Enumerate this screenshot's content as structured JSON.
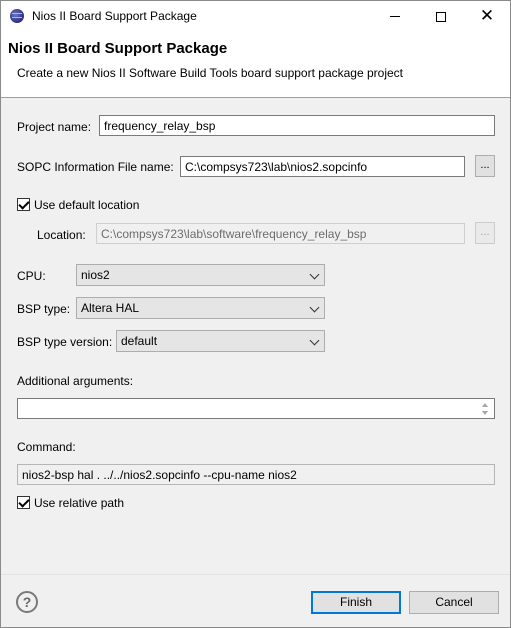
{
  "window": {
    "title": "Nios II Board Support Package",
    "minimize": "minimize",
    "maximize": "maximize",
    "close": "close"
  },
  "header": {
    "title": "Nios II Board Support Package",
    "description": "Create a new Nios II Software Build Tools board support package project"
  },
  "form": {
    "project_name_label": "Project name:",
    "project_name_value": "frequency_relay_bsp",
    "sopc_label": "SOPC Information File name:",
    "sopc_value": "C:\\compsys723\\lab\\nios2.sopcinfo",
    "browse_label": "...",
    "use_default_location_label": "Use default location",
    "use_default_location_checked": true,
    "location_label": "Location:",
    "location_value": "C:\\compsys723\\lab\\software\\frequency_relay_bsp",
    "cpu_label": "CPU:",
    "cpu_value": "nios2",
    "bsp_type_label": "BSP type:",
    "bsp_type_value": "Altera HAL",
    "bsp_version_label": "BSP type version:",
    "bsp_version_value": "default",
    "additional_args_label": "Additional arguments:",
    "additional_args_value": "",
    "command_label": "Command:",
    "command_value": "nios2-bsp hal . ../../nios2.sopcinfo --cpu-name nios2",
    "use_relative_path_label": "Use relative path",
    "use_relative_path_checked": true
  },
  "footer": {
    "help_glyph": "?",
    "finish_label": "Finish",
    "cancel_label": "Cancel"
  }
}
